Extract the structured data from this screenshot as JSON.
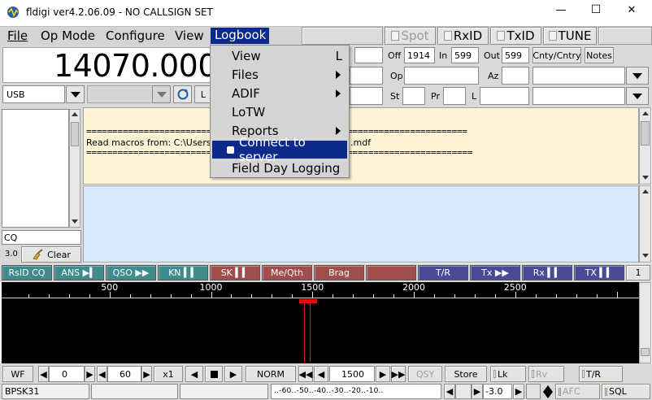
{
  "window": {
    "title": "fldigi ver4.2.06.09 - NO CALLSIGN SET",
    "controls": {
      "minimize": "—",
      "maximize": "☐",
      "close": "✕"
    }
  },
  "menubar": {
    "items": [
      "File",
      "Op Mode",
      "Configure",
      "View",
      "Logbook"
    ],
    "active": "Logbook",
    "toggles": {
      "spot": "Spot",
      "rxid": "RxID",
      "txid": "TxID",
      "tune": "TUNE"
    }
  },
  "frequency": {
    "display": "14070.000",
    "mode": "USB"
  },
  "logfields": {
    "off_label": "Off",
    "off_value": "1914",
    "in_label": "In",
    "in_value": "599",
    "out_label": "Out",
    "out_value": "599",
    "cnty_button": "Cnty/Cntry",
    "notes_button": "Notes",
    "op_label": "Op",
    "az_label": "Az",
    "st_label": "St",
    "pr_label": "Pr",
    "l_label": "L"
  },
  "rx_text": {
    "line1": "=========================================================================",
    "line2": "Read macros from: C:\\Users\\",
    "line2_tail": ".mdf",
    "line3": "=========================================================================="
  },
  "left_panel": {
    "cq_text": "CQ",
    "version_tag": "3.0",
    "clear_button": "Clear"
  },
  "logbook_menu": {
    "items": [
      {
        "label": "View",
        "shortcut": "L"
      },
      {
        "label": "Files",
        "submenu": true
      },
      {
        "label": "ADIF",
        "submenu": true
      },
      {
        "label": "LoTW"
      },
      {
        "label": "Reports",
        "submenu": true
      },
      {
        "label": "Connect to server",
        "checkbox": true
      },
      {
        "label": "Field Day Logging"
      }
    ]
  },
  "macros": {
    "labels": [
      "RsID CQ",
      "ANS ▶▍",
      "QSO ▶▶",
      "KN ▍▍",
      "SK ▍▍",
      "Me/Qth",
      "Brag",
      "",
      "T/R",
      "Tx ▶▶",
      "Rx ▍▍",
      "TX ▍▍"
    ],
    "set_number": "1",
    "colors": {
      "teal": "#3f8c8c",
      "red": "#a24d4d",
      "blue": "#4a4a96"
    }
  },
  "waterfall": {
    "scale": [
      "500",
      "1000",
      "1500",
      "2000",
      "2500"
    ],
    "cursor_hz": "1500",
    "cursor_color": "#e01010"
  },
  "wf_controls": {
    "wf_button": "WF",
    "offset": "0",
    "range": "60",
    "zoom": "x1",
    "norm_button": "NORM",
    "freq": "1500",
    "qsy": "QSY",
    "store": "Store",
    "lk": "Lk",
    "rv": "Rv",
    "tr": "T/R"
  },
  "statusbar": {
    "mode": "BPSK31",
    "imd_scale": "..-60..-50..-40..-30..-20..-10..",
    "squelch": "-3.0",
    "afc": "AFC",
    "sql": "SQL"
  }
}
